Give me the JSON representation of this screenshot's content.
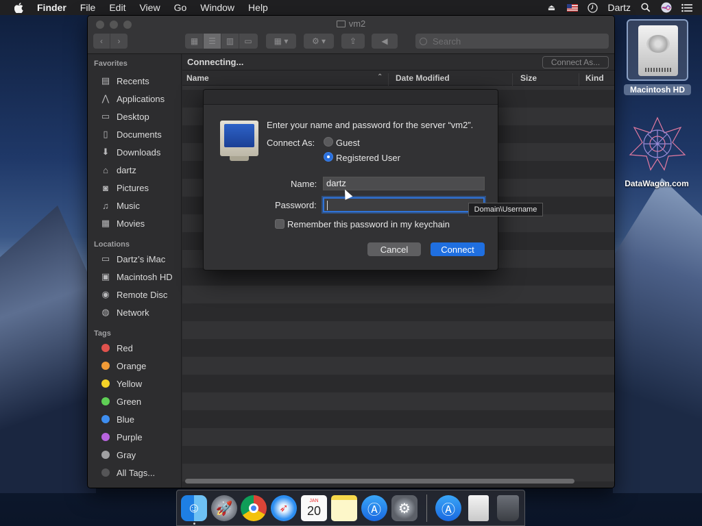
{
  "menubar": {
    "apple": "",
    "items": [
      "Finder",
      "File",
      "Edit",
      "View",
      "Go",
      "Window",
      "Help"
    ],
    "user": "Dartz"
  },
  "window": {
    "title": "vm2",
    "search_placeholder": "Search",
    "status": "Connecting...",
    "connect_as_button": "Connect As...",
    "columns": [
      "Name",
      "Date Modified",
      "Size",
      "Kind"
    ]
  },
  "sidebar": {
    "favorites_heading": "Favorites",
    "favorites": [
      {
        "label": "Recents",
        "icon": "recents-icon"
      },
      {
        "label": "Applications",
        "icon": "applications-icon"
      },
      {
        "label": "Desktop",
        "icon": "desktop-icon"
      },
      {
        "label": "Documents",
        "icon": "documents-icon"
      },
      {
        "label": "Downloads",
        "icon": "downloads-icon"
      },
      {
        "label": "dartz",
        "icon": "home-icon"
      },
      {
        "label": "Pictures",
        "icon": "pictures-icon"
      },
      {
        "label": "Music",
        "icon": "music-icon"
      },
      {
        "label": "Movies",
        "icon": "movies-icon"
      }
    ],
    "locations_heading": "Locations",
    "locations": [
      {
        "label": "Dartz’s iMac",
        "icon": "imac-icon"
      },
      {
        "label": "Macintosh HD",
        "icon": "hard-disk-icon"
      },
      {
        "label": "Remote Disc",
        "icon": "disc-icon"
      },
      {
        "label": "Network",
        "icon": "network-icon"
      }
    ],
    "tags_heading": "Tags",
    "tags": [
      {
        "label": "Red",
        "color": "#e0524d"
      },
      {
        "label": "Orange",
        "color": "#f09a37"
      },
      {
        "label": "Yellow",
        "color": "#f5d327"
      },
      {
        "label": "Green",
        "color": "#5fcf55"
      },
      {
        "label": "Blue",
        "color": "#3e8ef0"
      },
      {
        "label": "Purple",
        "color": "#b864de"
      },
      {
        "label": "Gray",
        "color": "#a0a0a2"
      },
      {
        "label": "All Tags...",
        "color": "#555557"
      }
    ]
  },
  "dialog": {
    "prompt": "Enter your name and password for the server “vm2”.",
    "connect_as_label": "Connect As:",
    "option_guest": "Guest",
    "option_registered": "Registered User",
    "selected_option": "Registered User",
    "name_label": "Name:",
    "name_value": "dartz",
    "password_label": "Password:",
    "password_value": "",
    "remember_label": "Remember this password in my keychain",
    "remember_checked": false,
    "cancel_button": "Cancel",
    "connect_button": "Connect",
    "accent_color": "#1f6fe0"
  },
  "tooltip": "Domain\\Username",
  "desktop": {
    "hd_label": "Macintosh HD",
    "datawagon_label": "DataWagon.com"
  },
  "dock": {
    "calendar_month": "JAN",
    "calendar_day": "20",
    "apps": [
      "finder-icon",
      "launchpad-icon",
      "chrome-icon",
      "safari-icon",
      "calendar-icon",
      "notes-icon",
      "app-store-icon",
      "system-preferences-icon",
      "app-store-folder-icon",
      "document-icon",
      "trash-icon"
    ]
  }
}
